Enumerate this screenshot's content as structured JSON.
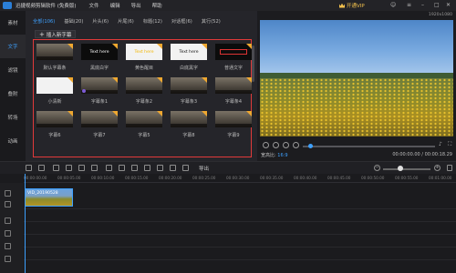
{
  "titlebar": {
    "app_title": "迅捷视频剪辑软件 (免费版)",
    "menu": [
      "文件",
      "编辑",
      "导出",
      "帮助"
    ],
    "vip_label": "开通VIP"
  },
  "leftnav": {
    "items": [
      "素材",
      "文字",
      "滤镜",
      "叠附",
      "转场",
      "动画",
      "配乐"
    ]
  },
  "panel": {
    "tabs": [
      "全部(106)",
      "基础(20)",
      "片头(6)",
      "片尾(6)",
      "标题(12)",
      "对话框(6)",
      "其行(52)"
    ],
    "add_button": "插入新字幕",
    "cards": [
      {
        "label": "默认字幕条",
        "style": "photo",
        "sample": "",
        "sample_color": "#ffffff",
        "corner": true
      },
      {
        "label": "黑底白字",
        "style": "black",
        "sample": "Text here",
        "sample_color": "#ffffff",
        "corner": true
      },
      {
        "label": "黄色醒目",
        "style": "white",
        "sample": "Text here",
        "sample_color": "#f2b705",
        "corner": true
      },
      {
        "label": "白底黑字",
        "style": "white",
        "sample": "Text here",
        "sample_color": "#111111",
        "corner": true
      },
      {
        "label": "普通文字",
        "style": "black",
        "sample": "",
        "sample_color": "#d33",
        "corner": true
      },
      {
        "label": "小清新",
        "style": "white",
        "sample": "",
        "sample_color": "#ffffff",
        "corner": true
      },
      {
        "label": "字幕条1",
        "style": "photo",
        "sample": "",
        "sample_color": "#ffffff",
        "corner": true
      },
      {
        "label": "字幕条2",
        "style": "photo",
        "sample": "",
        "sample_color": "#ffffff",
        "corner": true
      },
      {
        "label": "字幕条3",
        "style": "photo",
        "sample": "",
        "sample_color": "#ffffff",
        "corner": true
      },
      {
        "label": "字幕条4",
        "style": "photo",
        "sample": "",
        "sample_color": "#ffffff",
        "corner": true
      },
      {
        "label": "字幕6",
        "style": "photo",
        "sample": "",
        "sample_color": "#ffffff",
        "corner": true
      },
      {
        "label": "字幕7",
        "style": "photo",
        "sample": "",
        "sample_color": "#ffffff",
        "corner": true
      },
      {
        "label": "字幕5",
        "style": "photo",
        "sample": "",
        "sample_color": "#ffffff",
        "corner": true
      },
      {
        "label": "字幕8",
        "style": "photo",
        "sample": "",
        "sample_color": "#ffffff",
        "corner": true
      },
      {
        "label": "字幕9",
        "style": "photo",
        "sample": "",
        "sample_color": "#ffffff",
        "corner": true
      }
    ]
  },
  "preview": {
    "resolution": "1920x1080",
    "aspect_label": "宽高比:",
    "aspect_value": "16:9",
    "timecode": "00:00:00.00 / 00:00:18.29"
  },
  "toolbar": {
    "export_label": "导出"
  },
  "timeline": {
    "ticks": [
      "00:00:00.00",
      "00:00:05.00",
      "00:00:10.00",
      "00:00:15.00",
      "00:00:20.00",
      "00:00:25.00",
      "00:00:30.00",
      "00:00:35.00",
      "00:00:40.00",
      "00:00:45.00",
      "00:00:50.00",
      "00:00:55.00",
      "00:01:00.00"
    ],
    "clip_label": "VID_20190528"
  },
  "colors": {
    "accent": "#3ea1ff",
    "highlight_frame": "#e23a3a",
    "vip": "#f2c14e"
  }
}
